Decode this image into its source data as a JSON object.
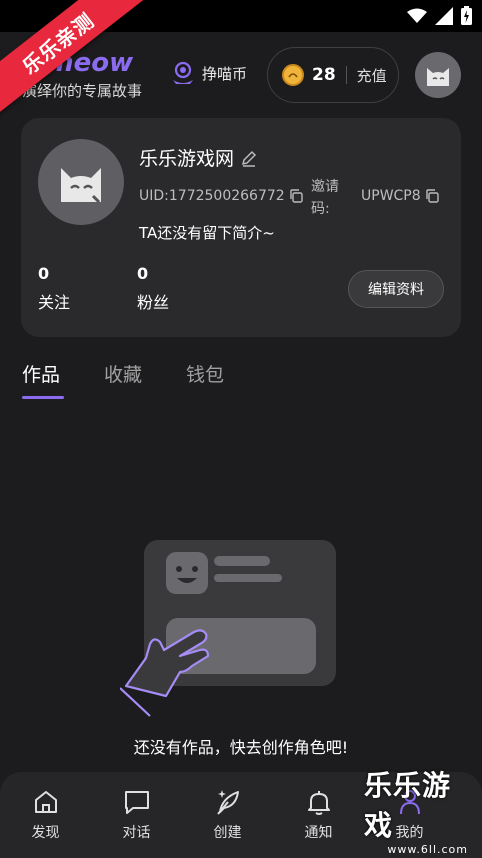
{
  "ribbon": {
    "text": "乐乐亲测"
  },
  "header": {
    "logo": "umeow",
    "slogan": "演绎你的专属故事",
    "earn_label": "挣喵币",
    "coin_count": "28",
    "recharge_label": "充值"
  },
  "profile": {
    "username": "乐乐游戏网",
    "uid": "UID:1772500266772",
    "invite_label": "邀请码:",
    "invite_code": "UPWCP8",
    "bio": "TA还没有留下简介~",
    "following_count": "0",
    "following_label": "关注",
    "followers_count": "0",
    "followers_label": "粉丝",
    "edit_label": "编辑资料"
  },
  "tabs": [
    {
      "label": "作品",
      "active": true
    },
    {
      "label": "收藏",
      "active": false
    },
    {
      "label": "钱包",
      "active": false
    }
  ],
  "empty_state": {
    "text": "还没有作品，快去创作角色吧!"
  },
  "bottom_nav": [
    {
      "label": "发现",
      "icon": "home-icon"
    },
    {
      "label": "对话",
      "icon": "chat-icon"
    },
    {
      "label": "创建",
      "icon": "feather-icon"
    },
    {
      "label": "通知",
      "icon": "bell-icon"
    },
    {
      "label": "我的",
      "icon": "person-icon"
    }
  ],
  "watermark": {
    "main": "乐乐游戏",
    "sub": "www.6ll.com"
  },
  "colors": {
    "accent": "#8b6cf0",
    "background": "#1c1c1e",
    "card": "#2a2a2c",
    "ribbon": "#e8283c"
  }
}
